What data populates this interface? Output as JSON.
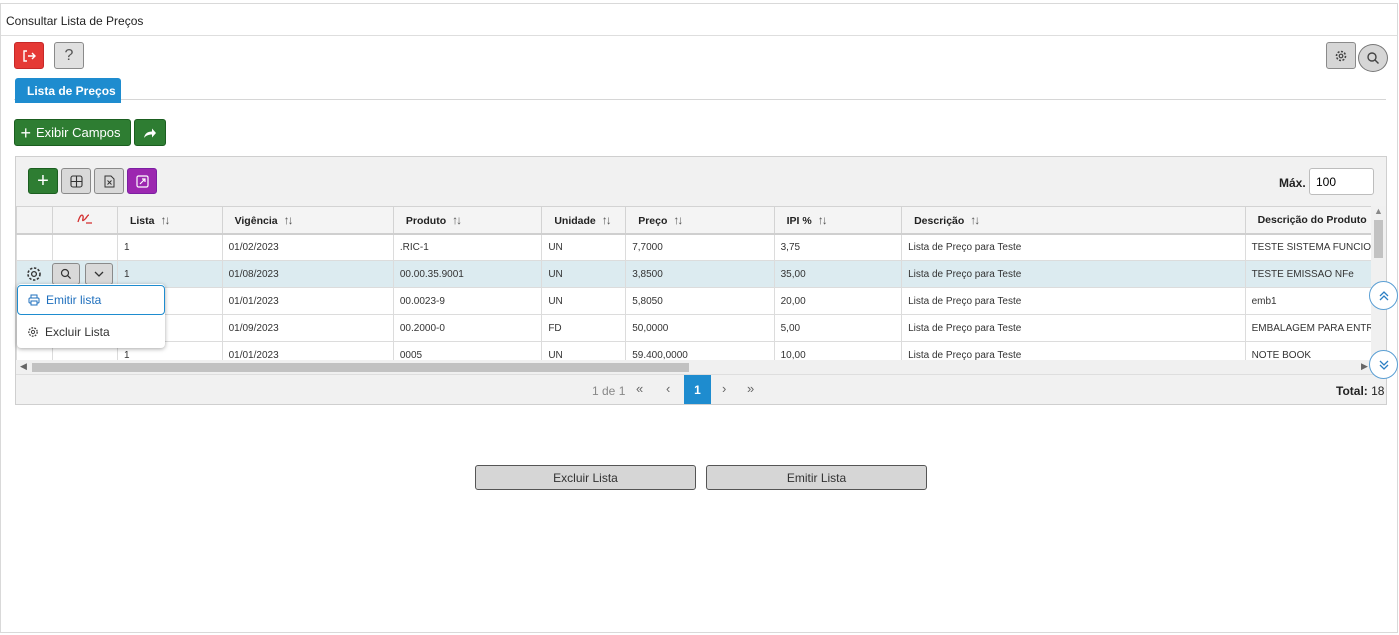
{
  "page": {
    "title": "Consultar Lista de Preços"
  },
  "tabs": [
    {
      "label": "Lista de Preços"
    }
  ],
  "toolbar": {
    "show_fields_label": "Exibir Campos"
  },
  "grid": {
    "max_label": "Máx.",
    "max_value": "100",
    "columns": [
      {
        "label": "Lista"
      },
      {
        "label": "Vigência"
      },
      {
        "label": "Produto"
      },
      {
        "label": "Unidade"
      },
      {
        "label": "Preço"
      },
      {
        "label": "IPI %"
      },
      {
        "label": "Descrição"
      },
      {
        "label": "Descrição do Produto"
      }
    ],
    "rows": [
      {
        "lista": "1",
        "vigencia": "01/02/2023",
        "produto": ".RIC-1",
        "unidade": "UN",
        "preco": "7,7000",
        "ipi": "3,75",
        "descricao": "Lista de Preço para Teste",
        "desc_produto": "TESTE SISTEMA FUNCIONA"
      },
      {
        "lista": "1",
        "vigencia": "01/08/2023",
        "produto": "00.00.35.9001",
        "unidade": "UN",
        "preco": "3,8500",
        "ipi": "35,00",
        "descricao": "Lista de Preço para Teste",
        "desc_produto": "TESTE EMISSAO  NFe"
      },
      {
        "lista": "",
        "vigencia": "01/01/2023",
        "produto": "00.0023-9",
        "unidade": "UN",
        "preco": "5,8050",
        "ipi": "20,00",
        "descricao": "Lista de Preço para Teste",
        "desc_produto": "emb1"
      },
      {
        "lista": "",
        "vigencia": "01/09/2023",
        "produto": "00.2000-0",
        "unidade": "FD",
        "preco": "50,0000",
        "ipi": "5,00",
        "descricao": "Lista de Preço para Teste",
        "desc_produto": "EMBALAGEM PARA ENTRE"
      },
      {
        "lista": "1",
        "vigencia": "01/01/2023",
        "produto": "0005",
        "unidade": "UN",
        "preco": "59.400,0000",
        "ipi": "10,00",
        "descricao": "Lista de Preço para Teste",
        "desc_produto": "NOTE BOOK"
      }
    ]
  },
  "context_menu": {
    "emitir": "Emitir lista",
    "excluir": "Excluir Lista"
  },
  "pagination": {
    "info": "1 de 1",
    "current_page": "1",
    "total_label": "Total:",
    "total_value": "18"
  },
  "actions": {
    "excluir": "Excluir Lista",
    "emitir": "Emitir Lista"
  },
  "colors": {
    "accent_blue": "#1e8ccf",
    "green": "#2e7d32",
    "red": "#e53935",
    "purple": "#9c27b0",
    "selected_row": "#dcebf0"
  },
  "icons": {
    "exit": "exit-icon",
    "help": "question-icon",
    "settings": "gear-icon",
    "search": "search-icon",
    "plus": "plus-icon",
    "share": "share-arrow-icon",
    "columns": "grid-icon",
    "excel": "excel-icon",
    "expand": "expand-icon",
    "signature": "signature-icon",
    "printer": "printer-icon",
    "chevron_down": "chevron-down-icon",
    "scroll_up": "double-chevron-up-icon",
    "scroll_down": "double-chevron-down-icon"
  }
}
